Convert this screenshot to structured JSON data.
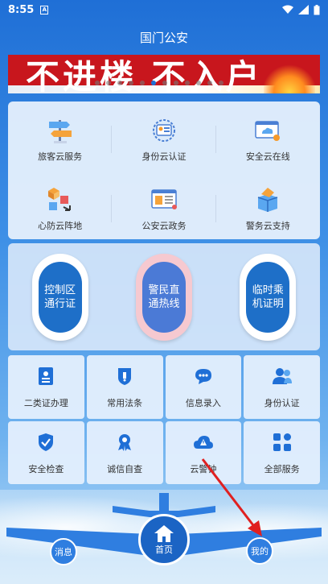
{
  "status": {
    "time": "8:55",
    "notif_icon": "a-icon"
  },
  "header": {
    "title": "国门公安"
  },
  "banner": {
    "text": "不进楼 不入户",
    "dots_total": 12,
    "dots_active_index": 5
  },
  "services_top": [
    {
      "label": "旅客云服务",
      "icon": "signpost-icon"
    },
    {
      "label": "身份云认证",
      "icon": "id-verify-icon"
    },
    {
      "label": "安全云在线",
      "icon": "cloud-screen-icon"
    },
    {
      "label": "心防云阵地",
      "icon": "blocks-icon"
    },
    {
      "label": "公安云政务",
      "icon": "document-icon"
    },
    {
      "label": "警务云支持",
      "icon": "box-icon"
    }
  ],
  "pills": [
    {
      "label": "控制区通行证"
    },
    {
      "label": "警民直通热线"
    },
    {
      "label": "临时乘机证明"
    }
  ],
  "tiles": [
    {
      "label": "二类证办理",
      "icon": "id-card-icon"
    },
    {
      "label": "常用法条",
      "icon": "badge-icon"
    },
    {
      "label": "信息录入",
      "icon": "chat-icon"
    },
    {
      "label": "身份认证",
      "icon": "users-icon"
    },
    {
      "label": "安全检查",
      "icon": "shield-check-icon"
    },
    {
      "label": "诚信自查",
      "icon": "medal-icon"
    },
    {
      "label": "云警钟",
      "icon": "cloud-alert-icon"
    },
    {
      "label": "全部服务",
      "icon": "grid-icon"
    }
  ],
  "bottom_nav": {
    "left": "消息",
    "center": "首页",
    "right": "我的"
  },
  "colors": {
    "primary": "#1f6fd6",
    "banner_red": "#c8161d",
    "arrow_red": "#e02020"
  }
}
